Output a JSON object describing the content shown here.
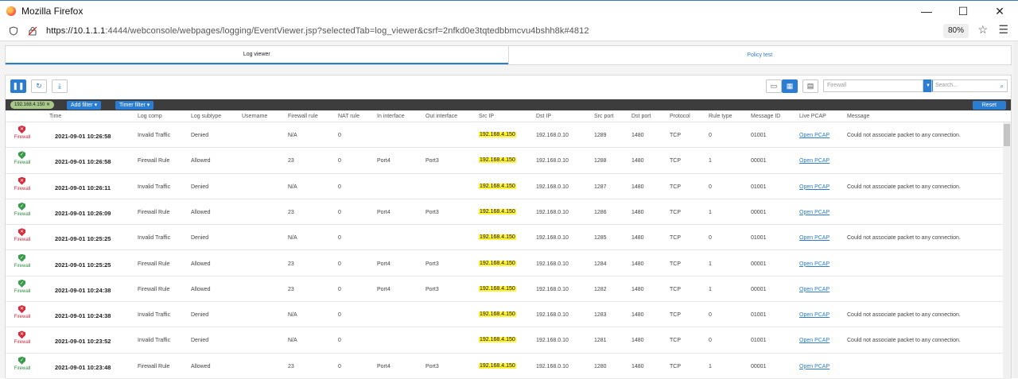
{
  "window": {
    "title": "Mozilla Firefox",
    "minimize": "—",
    "maximize": "☐",
    "close": "✕"
  },
  "urlbar": {
    "host": "https://10.1.1.1",
    "rest": ":4444/webconsole/webpages/logging/EventViewer.jsp?selectedTab=log_viewer&csrf=2nfkd0e3tqtedbbmcvu4bshh8k#4812",
    "zoom": "80%"
  },
  "tabs": {
    "log_viewer": "Log viewer",
    "policy_test": "Policy test"
  },
  "toolbar": {
    "log_type_placeholder": "Firewall",
    "search_placeholder": "Search..."
  },
  "filterbar": {
    "chip": "192.168.4.150",
    "chip_close": "✕",
    "add_filter": "Add filter",
    "timer_filter": "Timer filter",
    "reset": "Reset"
  },
  "columns": [
    "Time",
    "Log comp",
    "Log subtype",
    "Username",
    "Firewall rule",
    "NAT rule",
    "In interface",
    "Out interface",
    "Src IP",
    "Dst IP",
    "Src port",
    "Dst port",
    "Protocol",
    "Rule type",
    "Message ID",
    "Live PCAP",
    "Message"
  ],
  "rows": [
    {
      "status": "denied",
      "badge": "Firewall",
      "time": "2021-09-01 10:26:58",
      "log_comp": "Invalid Traffic",
      "subtype": "Denied",
      "username": "",
      "fw_rule": "N/A",
      "nat_rule": "0",
      "in_if": "",
      "out_if": "",
      "src_ip": "192.168.4.150",
      "dst_ip": "192.168.0.10",
      "src_port": "1289",
      "dst_port": "1480",
      "protocol": "TCP",
      "rule_type": "0",
      "msg_id": "01001",
      "pcap": "Open PCAP",
      "message": "Could not associate packet to any connection."
    },
    {
      "status": "allowed",
      "badge": "Firewall",
      "time": "2021-09-01 10:26:58",
      "log_comp": "Firewall Rule",
      "subtype": "Allowed",
      "username": "",
      "fw_rule": "23",
      "nat_rule": "0",
      "in_if": "Port4",
      "out_if": "Port3",
      "src_ip": "192.168.4.150",
      "dst_ip": "192.168.0.10",
      "src_port": "1288",
      "dst_port": "1480",
      "protocol": "TCP",
      "rule_type": "1",
      "msg_id": "00001",
      "pcap": "Open PCAP",
      "message": ""
    },
    {
      "status": "denied",
      "badge": "Firewall",
      "time": "2021-09-01 10:26:11",
      "log_comp": "Invalid Traffic",
      "subtype": "Denied",
      "username": "",
      "fw_rule": "N/A",
      "nat_rule": "0",
      "in_if": "",
      "out_if": "",
      "src_ip": "192.168.4.150",
      "dst_ip": "192.168.0.10",
      "src_port": "1287",
      "dst_port": "1480",
      "protocol": "TCP",
      "rule_type": "0",
      "msg_id": "01001",
      "pcap": "Open PCAP",
      "message": "Could not associate packet to any connection."
    },
    {
      "status": "allowed",
      "badge": "Firewall",
      "time": "2021-09-01 10:26:09",
      "log_comp": "Firewall Rule",
      "subtype": "Allowed",
      "username": "",
      "fw_rule": "23",
      "nat_rule": "0",
      "in_if": "Port4",
      "out_if": "Port3",
      "src_ip": "192.168.4.150",
      "dst_ip": "192.168.0.10",
      "src_port": "1286",
      "dst_port": "1480",
      "protocol": "TCP",
      "rule_type": "1",
      "msg_id": "00001",
      "pcap": "Open PCAP",
      "message": ""
    },
    {
      "status": "denied",
      "badge": "Firewall",
      "time": "2021-09-01 10:25:25",
      "log_comp": "Invalid Traffic",
      "subtype": "Denied",
      "username": "",
      "fw_rule": "N/A",
      "nat_rule": "0",
      "in_if": "",
      "out_if": "",
      "src_ip": "192.168.4.150",
      "dst_ip": "192.168.0.10",
      "src_port": "1285",
      "dst_port": "1480",
      "protocol": "TCP",
      "rule_type": "0",
      "msg_id": "01001",
      "pcap": "Open PCAP",
      "message": "Could not associate packet to any connection."
    },
    {
      "status": "allowed",
      "badge": "Firewall",
      "time": "2021-09-01 10:25:25",
      "log_comp": "Firewall Rule",
      "subtype": "Allowed",
      "username": "",
      "fw_rule": "23",
      "nat_rule": "0",
      "in_if": "Port4",
      "out_if": "Port3",
      "src_ip": "192.168.4.150",
      "dst_ip": "192.168.0.10",
      "src_port": "1284",
      "dst_port": "1480",
      "protocol": "TCP",
      "rule_type": "1",
      "msg_id": "00001",
      "pcap": "Open PCAP",
      "message": ""
    },
    {
      "status": "allowed",
      "badge": "Firewall",
      "time": "2021-09-01 10:24:38",
      "log_comp": "Firewall Rule",
      "subtype": "Allowed",
      "username": "",
      "fw_rule": "23",
      "nat_rule": "0",
      "in_if": "Port4",
      "out_if": "Port3",
      "src_ip": "192.168.4.150",
      "dst_ip": "192.168.0.10",
      "src_port": "1282",
      "dst_port": "1480",
      "protocol": "TCP",
      "rule_type": "1",
      "msg_id": "00001",
      "pcap": "Open PCAP",
      "message": ""
    },
    {
      "status": "denied",
      "badge": "Firewall",
      "time": "2021-09-01 10:24:38",
      "log_comp": "Invalid Traffic",
      "subtype": "Denied",
      "username": "",
      "fw_rule": "N/A",
      "nat_rule": "0",
      "in_if": "",
      "out_if": "",
      "src_ip": "192.168.4.150",
      "dst_ip": "192.168.0.10",
      "src_port": "1283",
      "dst_port": "1480",
      "protocol": "TCP",
      "rule_type": "0",
      "msg_id": "01001",
      "pcap": "Open PCAP",
      "message": "Could not associate packet to any connection."
    },
    {
      "status": "denied",
      "badge": "Firewall",
      "time": "2021-09-01 10:23:52",
      "log_comp": "Invalid Traffic",
      "subtype": "Denied",
      "username": "",
      "fw_rule": "N/A",
      "nat_rule": "0",
      "in_if": "",
      "out_if": "",
      "src_ip": "192.168.4.150",
      "dst_ip": "192.168.0.10",
      "src_port": "1281",
      "dst_port": "1480",
      "protocol": "TCP",
      "rule_type": "0",
      "msg_id": "01001",
      "pcap": "Open PCAP",
      "message": "Could not associate packet to any connection."
    },
    {
      "status": "allowed",
      "badge": "Firewall",
      "time": "2021-09-01 10:23:48",
      "log_comp": "Firewall Rule",
      "subtype": "Allowed",
      "username": "",
      "fw_rule": "23",
      "nat_rule": "0",
      "in_if": "Port4",
      "out_if": "Port3",
      "src_ip": "192.168.4.150",
      "dst_ip": "192.168.0.10",
      "src_port": "1280",
      "dst_port": "1480",
      "protocol": "TCP",
      "rule_type": "1",
      "msg_id": "00001",
      "pcap": "Open PCAP",
      "message": ""
    }
  ],
  "colors": {
    "accent": "#2a7dd1",
    "highlight": "#fff23a",
    "denied": "#d72b3b",
    "allowed": "#3a9c4a",
    "filterbar": "#3d3d3d"
  }
}
